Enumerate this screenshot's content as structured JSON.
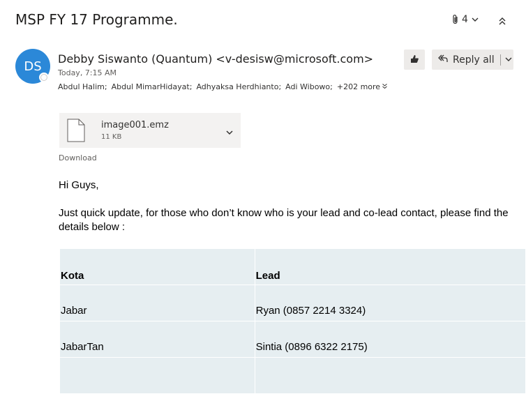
{
  "header": {
    "subject": "MSP FY 17 Programme.",
    "attachment_count": "4"
  },
  "message": {
    "avatar_initials": "DS",
    "sender": "Debby Siswanto (Quantum) <v-desisw@microsoft.com>",
    "time": "Today, 7:15 AM",
    "recipients": [
      "Abdul Halim;",
      "Abdul MimarHidayat;",
      "Adhyaksa Herdhianto;",
      "Adi Wibowo;"
    ],
    "more_recipients": "+202 more"
  },
  "actions": {
    "reply_all_label": "Reply all"
  },
  "attachment": {
    "file_name": "image001.emz",
    "file_size": "11 KB",
    "download_label": "Download"
  },
  "body": {
    "greeting": "Hi Guys,",
    "paragraph": "Just quick update, for those who don’t know who is your lead and co-lead contact, please find the details below :"
  },
  "table": {
    "headers": [
      "Kota",
      "Lead"
    ],
    "rows": [
      [
        "Jabar",
        "Ryan (0857 2214 3324)"
      ],
      [
        "JabarTan",
        "Sintia (0896 6322 2175)"
      ]
    ]
  },
  "colors": {
    "avatar_bg": "#2b88d8",
    "button_bg": "#edebe9",
    "table_bg": "#e6eef1"
  }
}
